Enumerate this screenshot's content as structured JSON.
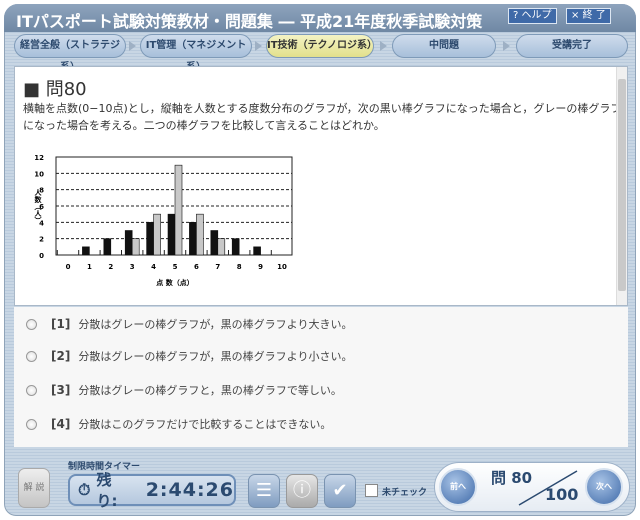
{
  "title": "ITパスポート試験対策教材・問題集 ― 平成21年度秋季試験対策",
  "help_label": "? ヘルプ",
  "exit_label": "× 終 了",
  "nav": [
    "経営全般（ストラテジ系）",
    "IT管理（マネジメント系）",
    "IT技術（テクノロジ系）",
    "中問題",
    "受講完了"
  ],
  "question": {
    "title": "■ 問80",
    "text": "横軸を点数(0−10点)とし，縦軸を人数とする度数分布のグラフが，次の黒い棒グラフになった場合と，グレーの棒グラフになった場合を考える。二つの棒グラフを比較して言えることはどれか。"
  },
  "chart_data": {
    "type": "bar",
    "categories": [
      "0",
      "1",
      "2",
      "3",
      "4",
      "5",
      "6",
      "7",
      "8",
      "9",
      "10"
    ],
    "series": [
      {
        "name": "black",
        "color": "#111111",
        "values": [
          0,
          1,
          2,
          3,
          4,
          5,
          4,
          3,
          2,
          1,
          0
        ]
      },
      {
        "name": "gray",
        "color": "#c8c8c8",
        "values": [
          0,
          0,
          0,
          2,
          5,
          11,
          5,
          2,
          0,
          0,
          0
        ]
      }
    ],
    "xlabel": "点 数（点）",
    "ylabel": "人数（人）",
    "yticks": [
      "0",
      "2",
      "4",
      "6",
      "8",
      "10",
      "12"
    ],
    "ylim": [
      0,
      12
    ],
    "grid": "dashed horizontal"
  },
  "choices": [
    {
      "num": "[1]",
      "text": "分散はグレーの棒グラフが，黒の棒グラフより大きい。"
    },
    {
      "num": "[2]",
      "text": "分散はグレーの棒グラフが，黒の棒グラフより小さい。"
    },
    {
      "num": "[3]",
      "text": "分散はグレーの棒グラフと，黒の棒グラフで等しい。"
    },
    {
      "num": "[4]",
      "text": "分散はこのグラフだけで比較することはできない。"
    }
  ],
  "footer": {
    "explain": "解 説",
    "timer_label": "制限時間タイマー",
    "timer_prefix": "残り:",
    "timer_value": "2:44:26",
    "uncheck": "未チェック",
    "prev": "前へ",
    "next": "次へ",
    "current": "問 80",
    "total": "100"
  }
}
